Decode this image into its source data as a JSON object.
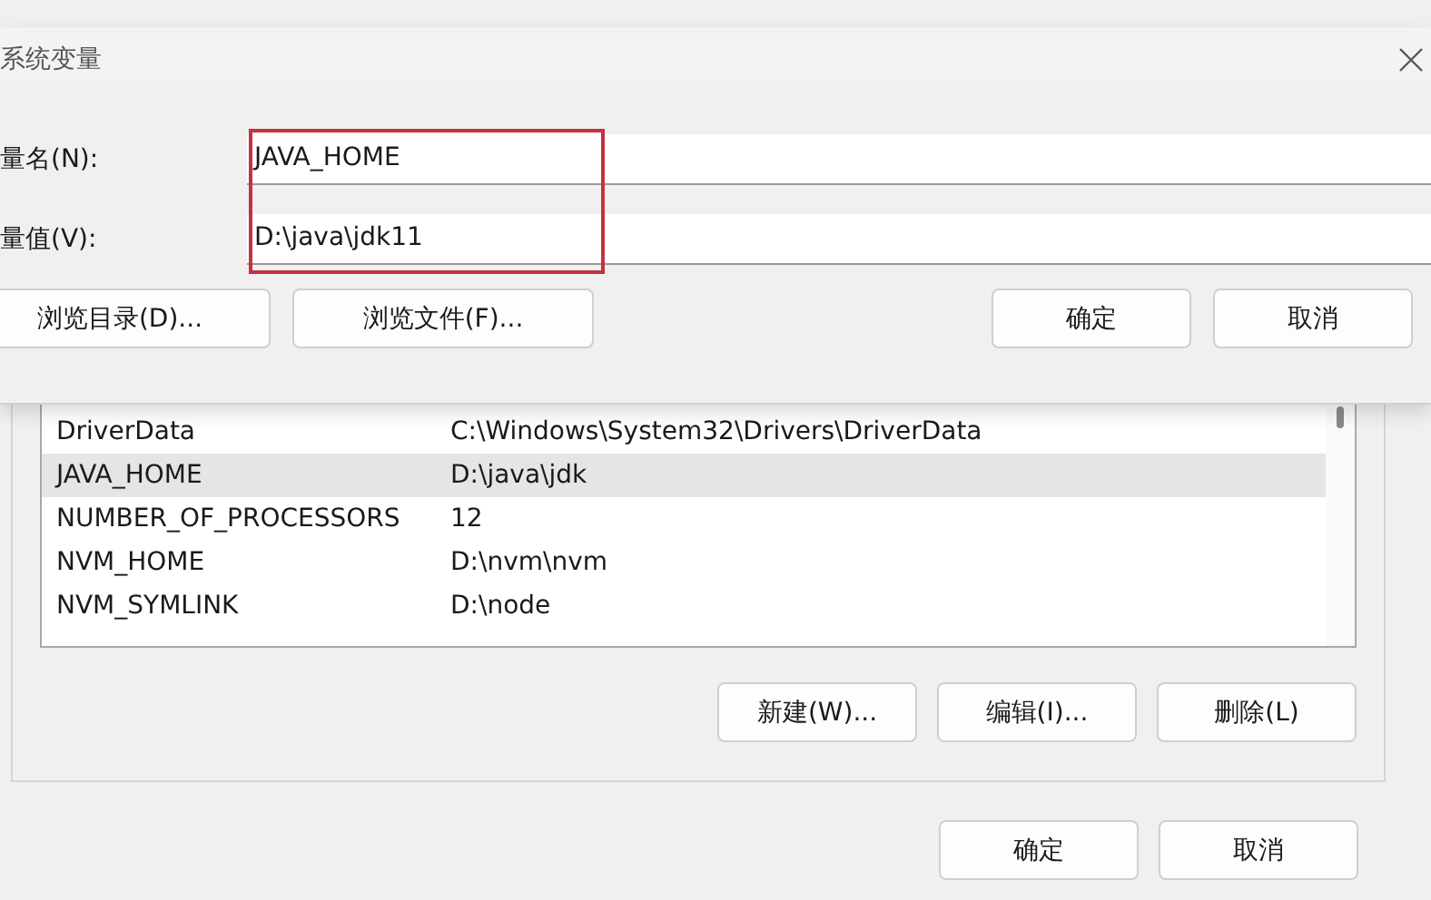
{
  "background_window": {
    "variables": [
      {
        "name": "DriverData",
        "value": "C:\\Windows\\System32\\Drivers\\DriverData",
        "selected": false
      },
      {
        "name": "JAVA_HOME",
        "value": "D:\\java\\jdk",
        "selected": true
      },
      {
        "name": "NUMBER_OF_PROCESSORS",
        "value": "12",
        "selected": false
      },
      {
        "name": "NVM_HOME",
        "value": "D:\\nvm\\nvm",
        "selected": false
      },
      {
        "name": "NVM_SYMLINK",
        "value": "D:\\node",
        "selected": false
      }
    ],
    "list_buttons": [
      "新建(W)...",
      "编辑(I)...",
      "删除(L)"
    ],
    "footer_buttons": [
      "确定",
      "取消"
    ]
  },
  "dialog": {
    "title": "系统变量",
    "fields": [
      {
        "label": "量名(N):",
        "value": "JAVA_HOME"
      },
      {
        "label": "量值(V):",
        "value": "D:\\java\\jdk11"
      }
    ],
    "browse_buttons": [
      "浏览目录(D)...",
      "浏览文件(F)..."
    ],
    "buttons": [
      "确定",
      "取消"
    ]
  }
}
